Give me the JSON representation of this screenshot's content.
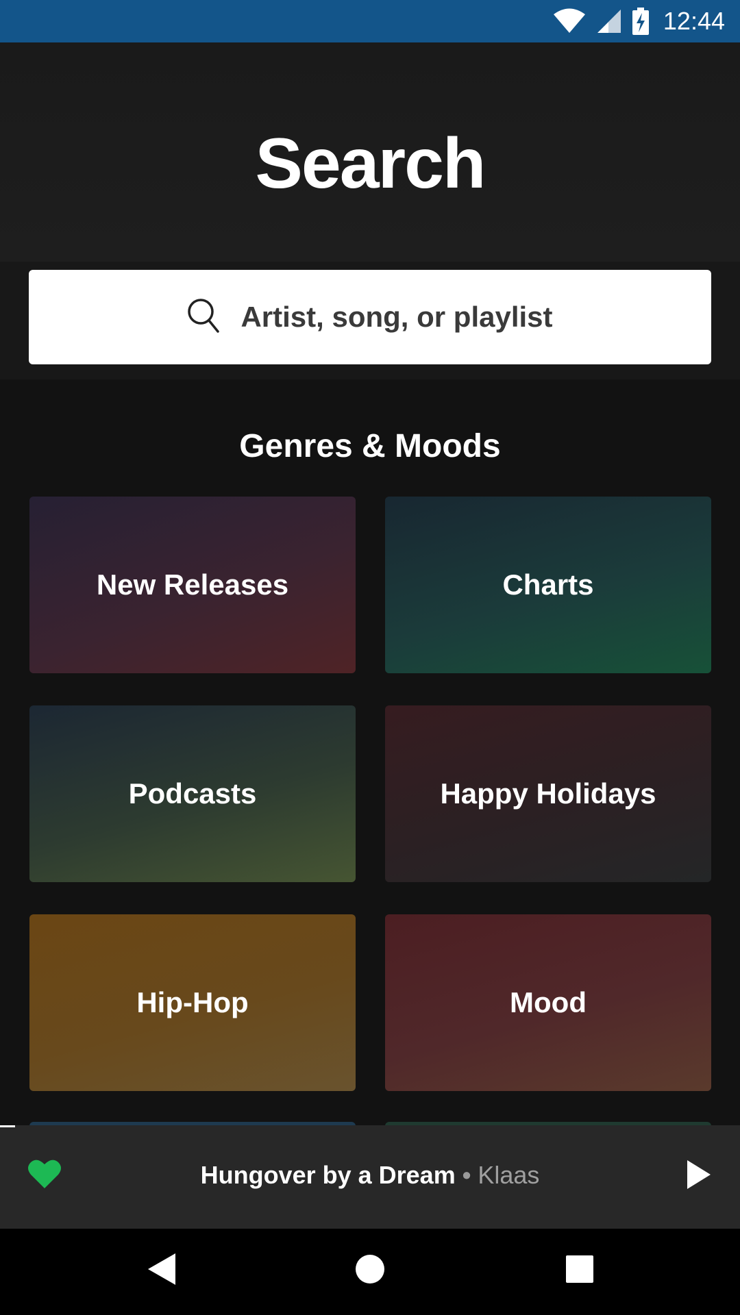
{
  "status_bar": {
    "time": "12:44",
    "icons": [
      "wifi-icon",
      "signal-icon",
      "battery-charging-icon"
    ],
    "background": "#13558a"
  },
  "header": {
    "title": "Search"
  },
  "search": {
    "placeholder": "Artist, song, or playlist",
    "icon": "search-icon"
  },
  "genres": {
    "title": "Genres & Moods",
    "tiles": [
      {
        "label": "New Releases"
      },
      {
        "label": "Charts"
      },
      {
        "label": "Podcasts"
      },
      {
        "label": "Happy Holidays"
      },
      {
        "label": "Hip-Hop"
      },
      {
        "label": "Mood"
      }
    ]
  },
  "now_playing": {
    "track": "Hungover by a Dream",
    "separator": " • ",
    "artist": "Klaas",
    "liked": true,
    "progress_fraction": 0.02,
    "heart_color": "#1db954"
  },
  "nav": {
    "buttons": [
      "back-icon",
      "home-icon",
      "recents-icon"
    ]
  },
  "colors": {
    "background": "#121212",
    "accent": "#1db954"
  }
}
